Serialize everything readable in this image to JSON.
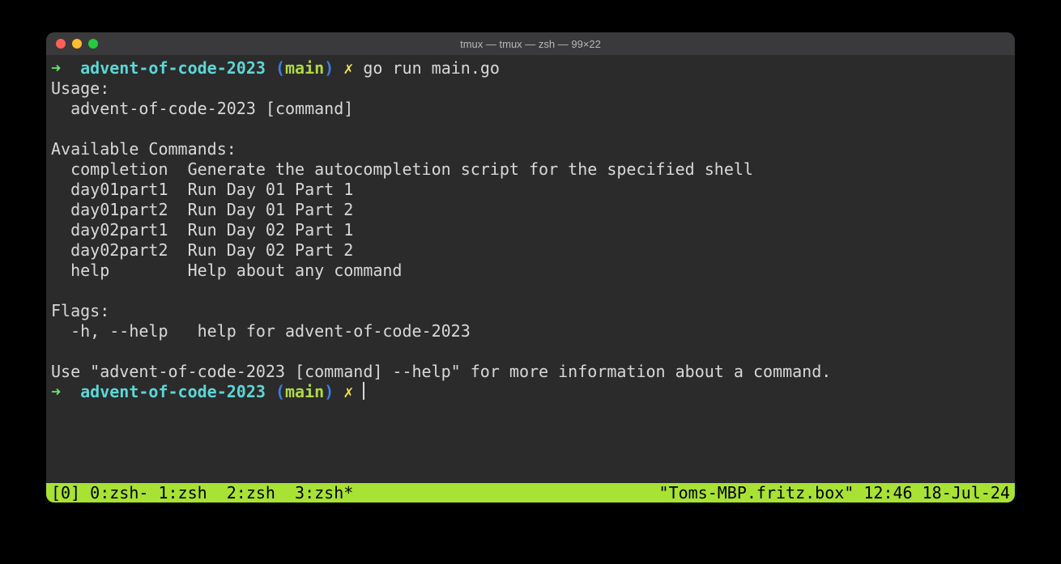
{
  "window": {
    "title": "tmux — tmux — zsh — 99×22"
  },
  "prompt1": {
    "arrow": "➜",
    "dir": "advent-of-code-2023",
    "branch_open": "(",
    "branch": "main",
    "branch_close": ")",
    "x": "✗",
    "command": "go run main.go"
  },
  "output": {
    "usage_label": "Usage:",
    "usage_line": "  advent-of-code-2023 [command]",
    "available_label": "Available Commands:",
    "cmd_completion": "  completion  Generate the autocompletion script for the specified shell",
    "cmd_d01p1": "  day01part1  Run Day 01 Part 1",
    "cmd_d01p2": "  day01part2  Run Day 01 Part 2",
    "cmd_d02p1": "  day02part1  Run Day 02 Part 1",
    "cmd_d02p2": "  day02part2  Run Day 02 Part 2",
    "cmd_help": "  help        Help about any command",
    "flags_label": "Flags:",
    "flags_line": "  -h, --help   help for advent-of-code-2023",
    "hint": "Use \"advent-of-code-2023 [command] --help\" for more information about a command."
  },
  "prompt2": {
    "arrow": "➜",
    "dir": "advent-of-code-2023",
    "branch_open": "(",
    "branch": "main",
    "branch_close": ")",
    "x": "✗"
  },
  "statusbar": {
    "left": "[0] 0:zsh- 1:zsh  2:zsh  3:zsh*",
    "right": "\"Toms-MBP.fritz.box\" 12:46 18-Jul-24"
  }
}
